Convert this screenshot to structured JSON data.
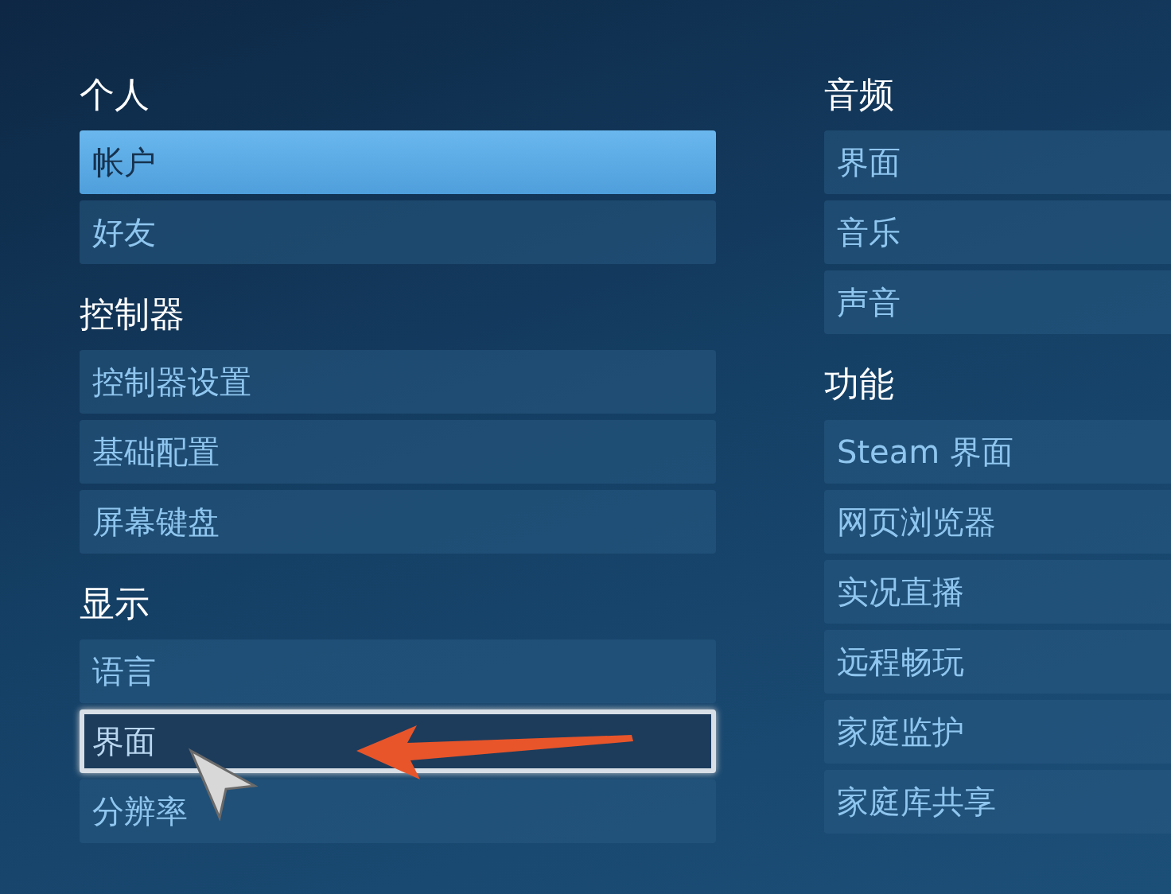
{
  "columns": [
    {
      "sections": [
        {
          "title": "个人",
          "items": [
            {
              "label": "帐户",
              "selected": true,
              "focused": false
            },
            {
              "label": "好友",
              "selected": false,
              "focused": false
            }
          ]
        },
        {
          "title": "控制器",
          "items": [
            {
              "label": "控制器设置",
              "selected": false,
              "focused": false
            },
            {
              "label": "基础配置",
              "selected": false,
              "focused": false
            },
            {
              "label": "屏幕键盘",
              "selected": false,
              "focused": false
            }
          ]
        },
        {
          "title": "显示",
          "items": [
            {
              "label": "语言",
              "selected": false,
              "focused": false
            },
            {
              "label": "界面",
              "selected": false,
              "focused": true
            },
            {
              "label": "分辨率",
              "selected": false,
              "focused": false
            }
          ]
        }
      ]
    },
    {
      "sections": [
        {
          "title": "音频",
          "items": [
            {
              "label": "界面",
              "selected": false,
              "focused": false
            },
            {
              "label": "音乐",
              "selected": false,
              "focused": false
            },
            {
              "label": "声音",
              "selected": false,
              "focused": false
            }
          ]
        },
        {
          "title": "功能",
          "items": [
            {
              "label": "Steam 界面",
              "selected": false,
              "focused": false
            },
            {
              "label": "网页浏览器",
              "selected": false,
              "focused": false
            },
            {
              "label": "实况直播",
              "selected": false,
              "focused": false
            },
            {
              "label": "远程畅玩",
              "selected": false,
              "focused": false
            },
            {
              "label": "家庭监护",
              "selected": false,
              "focused": false
            },
            {
              "label": "家庭库共享",
              "selected": false,
              "focused": false
            }
          ]
        }
      ]
    }
  ]
}
